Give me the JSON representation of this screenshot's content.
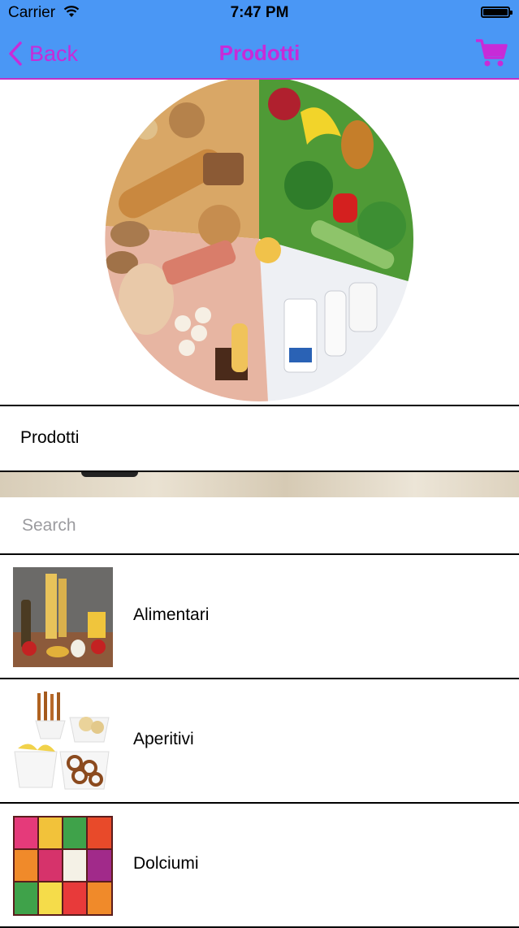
{
  "status_bar": {
    "carrier": "Carrier",
    "time": "7:47 PM"
  },
  "nav": {
    "back_label": "Back",
    "title": "Prodotti",
    "cart_icon": "cart-icon",
    "accent_color": "#c72bd8",
    "bar_color": "#4a97f5"
  },
  "hero": {
    "image": "food-wheel-image"
  },
  "section": {
    "title": "Prodotti"
  },
  "search": {
    "placeholder": "Search",
    "value": ""
  },
  "categories": [
    {
      "label": "Alimentari",
      "image": "pasta-groceries-image"
    },
    {
      "label": "Aperitivi",
      "image": "snacks-bowls-image"
    },
    {
      "label": "Dolciumi",
      "image": "candy-image"
    }
  ]
}
